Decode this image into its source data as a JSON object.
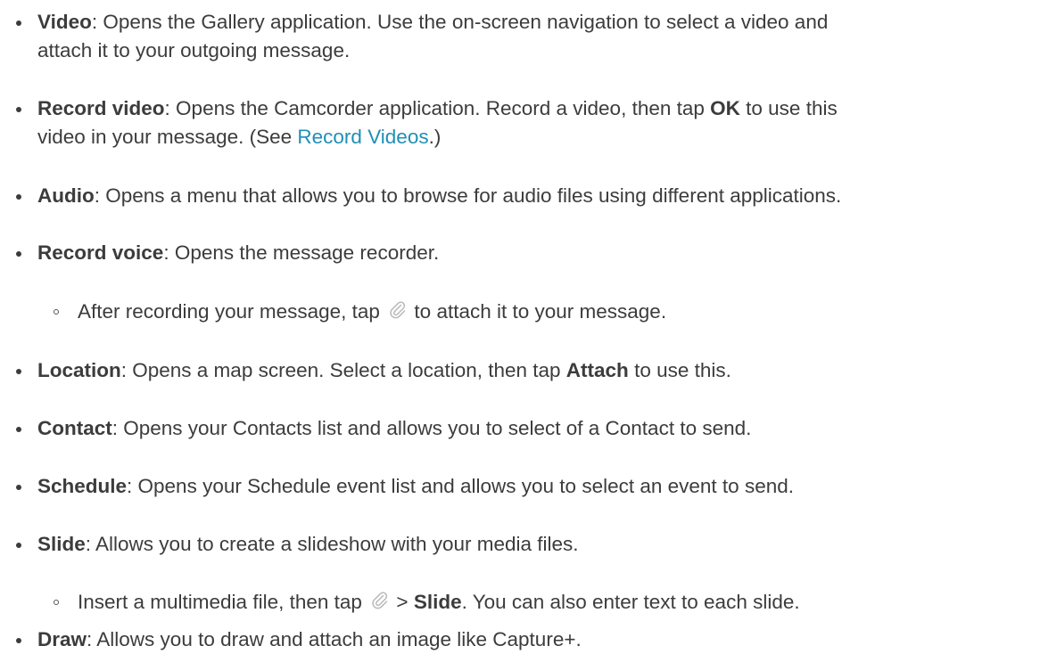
{
  "items": [
    {
      "term": "Video",
      "line1": ": Opens the Gallery application. Use the on-screen navigation to select a video and",
      "line2": "attach it to your outgoing message."
    },
    {
      "term": "Record video",
      "line1_a": ": Opens the Camcorder application. Record a video, then tap ",
      "line1_bold": "OK",
      "line1_b": " to use this",
      "line2_a": "video in your message. (See ",
      "link": "Record Videos",
      "line2_b": ".)"
    },
    {
      "term": "Audio",
      "text": ": Opens a menu that allows you to browse for audio files using different applications."
    },
    {
      "term": "Record voice",
      "text": ": Opens the message recorder."
    },
    {
      "sub_a": "After recording your message, tap ",
      "sub_b": " to attach it to your message."
    },
    {
      "term": "Location",
      "text_a": ": Opens a map screen. Select a location, then tap ",
      "bold": "Attach",
      "text_b": " to use this."
    },
    {
      "term": "Contact",
      "text": ": Opens your Contacts list and allows you to select of a Contact to send."
    },
    {
      "term": "Schedule",
      "text": ": Opens your Schedule event list and allows you to select an event to send."
    },
    {
      "term": "Slide",
      "text": ": Allows you to create a slideshow with your media files."
    },
    {
      "sub_a": "Insert a multimedia file, then tap ",
      "sub_mid": " > ",
      "bold": "Slide",
      "sub_b": ". You can also enter text to each slide."
    },
    {
      "term": "Draw",
      "text": ": Allows you to draw and attach an image like Capture+."
    }
  ],
  "icons": {
    "attach": "paperclip-icon"
  }
}
